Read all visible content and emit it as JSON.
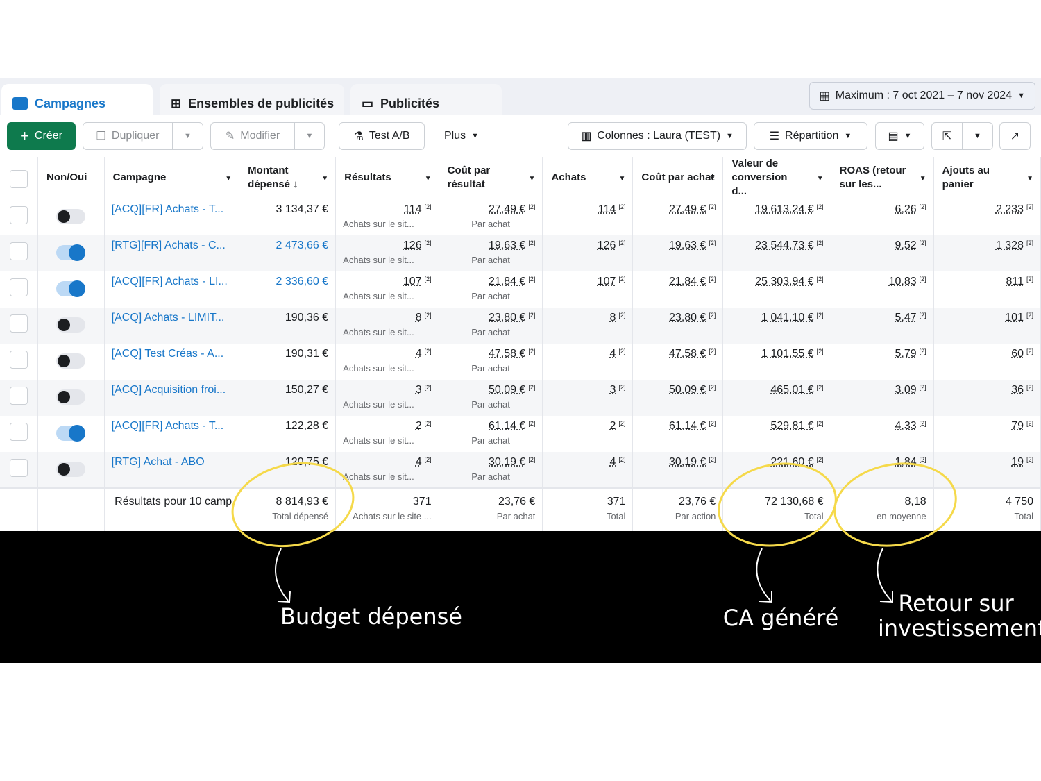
{
  "tabs": [
    {
      "label": "Campagnes"
    },
    {
      "label": "Ensembles de publicités"
    },
    {
      "label": "Publicités"
    }
  ],
  "date_range": "Maximum : 7 oct 2021 – 7 nov 2024",
  "toolbar": {
    "create": "Créer",
    "duplicate": "Dupliquer",
    "edit": "Modifier",
    "ab_test": "Test A/B",
    "more": "Plus",
    "columns": "Colonnes : Laura (TEST)",
    "breakdown": "Répartition"
  },
  "headers": [
    "Non/Oui",
    "Campagne",
    "Montant dépensé ↓",
    "Résultats",
    "Coût par résultat",
    "Achats",
    "Coût par achat",
    "Valeur de conversion d...",
    "ROAS (retour sur les...",
    "Ajouts au panier"
  ],
  "footnote": "[2]",
  "rows": [
    {
      "on": false,
      "name": "[ACQ][FR] Achats - T...",
      "spent": "3 134,37 €",
      "spent_link": false,
      "results": "114",
      "results_sub": "Achats sur le sit...",
      "cpr": "27,49 €",
      "cpr_sub": "Par achat",
      "purchases": "114",
      "cpp": "27,49 €",
      "value": "19 613,24 €",
      "roas": "6,26",
      "cart": "2 233"
    },
    {
      "on": true,
      "name": "[RTG][FR] Achats - C...",
      "spent": "2 473,66 €",
      "spent_link": true,
      "results": "126",
      "results_sub": "Achats sur le sit...",
      "cpr": "19,63 €",
      "cpr_sub": "Par achat",
      "purchases": "126",
      "cpp": "19,63 €",
      "value": "23 544,73 €",
      "roas": "9,52",
      "cart": "1 328"
    },
    {
      "on": true,
      "name": "[ACQ][FR] Achats - LI...",
      "spent": "2 336,60 €",
      "spent_link": true,
      "results": "107",
      "results_sub": "Achats sur le sit...",
      "cpr": "21,84 €",
      "cpr_sub": "Par achat",
      "purchases": "107",
      "cpp": "21,84 €",
      "value": "25 303,94 €",
      "roas": "10,83",
      "cart": "811"
    },
    {
      "on": false,
      "name": "[ACQ] Achats - LIMIT...",
      "spent": "190,36 €",
      "spent_link": false,
      "results": "8",
      "results_sub": "Achats sur le sit...",
      "cpr": "23,80 €",
      "cpr_sub": "Par achat",
      "purchases": "8",
      "cpp": "23,80 €",
      "value": "1 041,10 €",
      "roas": "5,47",
      "cart": "101"
    },
    {
      "on": false,
      "name": "[ACQ] Test Créas - A...",
      "spent": "190,31 €",
      "spent_link": false,
      "results": "4",
      "results_sub": "Achats sur le sit...",
      "cpr": "47,58 €",
      "cpr_sub": "Par achat",
      "purchases": "4",
      "cpp": "47,58 €",
      "value": "1 101,55 €",
      "roas": "5,79",
      "cart": "60"
    },
    {
      "on": false,
      "name": "[ACQ] Acquisition froi...",
      "spent": "150,27 €",
      "spent_link": false,
      "results": "3",
      "results_sub": "Achats sur le sit...",
      "cpr": "50,09 €",
      "cpr_sub": "Par achat",
      "purchases": "3",
      "cpp": "50,09 €",
      "value": "465,01 €",
      "roas": "3,09",
      "cart": "36"
    },
    {
      "on": true,
      "name": "[ACQ][FR] Achats - T...",
      "spent": "122,28 €",
      "spent_link": false,
      "results": "2",
      "results_sub": "Achats sur le sit...",
      "cpr": "61,14 €",
      "cpr_sub": "Par achat",
      "purchases": "2",
      "cpp": "61,14 €",
      "value": "529,81 €",
      "roas": "4,33",
      "cart": "79"
    },
    {
      "on": false,
      "name": "[RTG] Achat - ABO",
      "spent": "120,75 €",
      "spent_link": false,
      "results": "4",
      "results_sub": "Achats sur le sit...",
      "cpr": "30,19 €",
      "cpr_sub": "Par achat",
      "purchases": "4",
      "cpp": "30,19 €",
      "value": "221,60 €",
      "roas": "1,84",
      "cart": "19"
    }
  ],
  "totals": {
    "label": "Résultats pour 10 camp",
    "spent": "8 814,93 €",
    "spent_sub": "Total dépensé",
    "results": "371",
    "results_sub": "Achats sur le site ...",
    "cpr": "23,76 €",
    "cpr_sub": "Par achat",
    "purchases": "371",
    "purchases_sub": "Total",
    "cpp": "23,76 €",
    "cpp_sub": "Par action",
    "value": "72 130,68 €",
    "value_sub": "Total",
    "roas": "8,18",
    "roas_sub": "en moyenne",
    "cart": "4 750",
    "cart_sub": "Total"
  },
  "annotations": {
    "budget": "Budget dépensé",
    "ca": "CA généré",
    "roi": "Retour sur investissement"
  },
  "colors": {
    "accent": "#1877c9",
    "create": "#0e7a4d",
    "highlight": "#f5d94a"
  }
}
